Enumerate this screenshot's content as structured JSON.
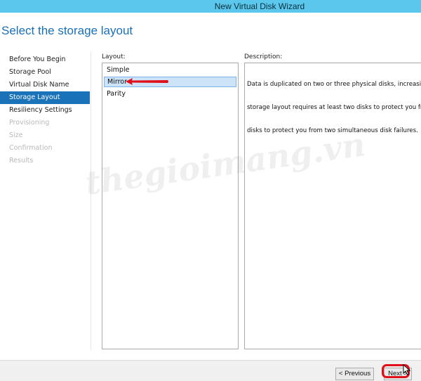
{
  "window": {
    "title": "New Virtual Disk Wizard"
  },
  "page": {
    "heading": "Select the storage layout"
  },
  "nav": {
    "items": [
      {
        "label": "Before You Begin",
        "state": "done"
      },
      {
        "label": "Storage Pool",
        "state": "done"
      },
      {
        "label": "Virtual Disk Name",
        "state": "done"
      },
      {
        "label": "Storage Layout",
        "state": "active"
      },
      {
        "label": "Resiliency Settings",
        "state": "done"
      },
      {
        "label": "Provisioning",
        "state": "disabled"
      },
      {
        "label": "Size",
        "state": "disabled"
      },
      {
        "label": "Confirmation",
        "state": "disabled"
      },
      {
        "label": "Results",
        "state": "disabled"
      }
    ]
  },
  "layout": {
    "label": "Layout:",
    "options": [
      "Simple",
      "Mirror",
      "Parity"
    ],
    "selected": "Mirror"
  },
  "description": {
    "label": "Description:",
    "lines": [
      "Data is duplicated on two or three physical disks, increasing rel",
      "storage layout requires at least two disks to protect you from a",
      "disks to protect you from two simultaneous disk failures."
    ]
  },
  "footer": {
    "previous_label": "< Previous",
    "next_label": "Next >"
  },
  "watermark": "thegioimang.vn",
  "colors": {
    "titlebar": "#5bc7ec",
    "heading": "#1a6fb5",
    "active_nav": "#1a73b8",
    "annotation": "#e0101a"
  }
}
